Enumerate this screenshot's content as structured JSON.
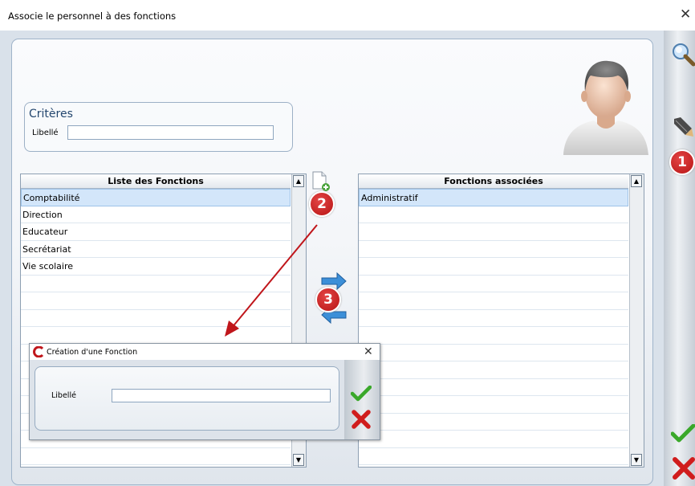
{
  "window": {
    "title": "Associe le personnel à des fonctions",
    "close_glyph": "✕"
  },
  "criteria": {
    "title": "Critères",
    "label_field": "Libellé",
    "value": ""
  },
  "left_list": {
    "header": "Liste des Fonctions",
    "items": [
      "Comptabilité",
      "Direction",
      "Educateur",
      "Secrétariat",
      "Vie scolaire"
    ],
    "selected_index": 0
  },
  "right_list": {
    "header": "Fonctions associées",
    "items": [
      "Administratif"
    ],
    "selected_index": 0
  },
  "badges": {
    "one": "1",
    "two": "2",
    "three": "3"
  },
  "dialog": {
    "title": "Création d'une Fonction",
    "close_glyph": "✕",
    "label_field": "Libellé",
    "value": ""
  },
  "icons": {
    "toolbar": [
      "search-icon",
      "edit-pen-icon",
      "validate-check-icon",
      "cancel-x-icon"
    ],
    "middle": [
      "new-document-icon",
      "transfer-arrows-icon"
    ],
    "accent_red": "#c0161b",
    "accent_green": "#3aa82a"
  }
}
